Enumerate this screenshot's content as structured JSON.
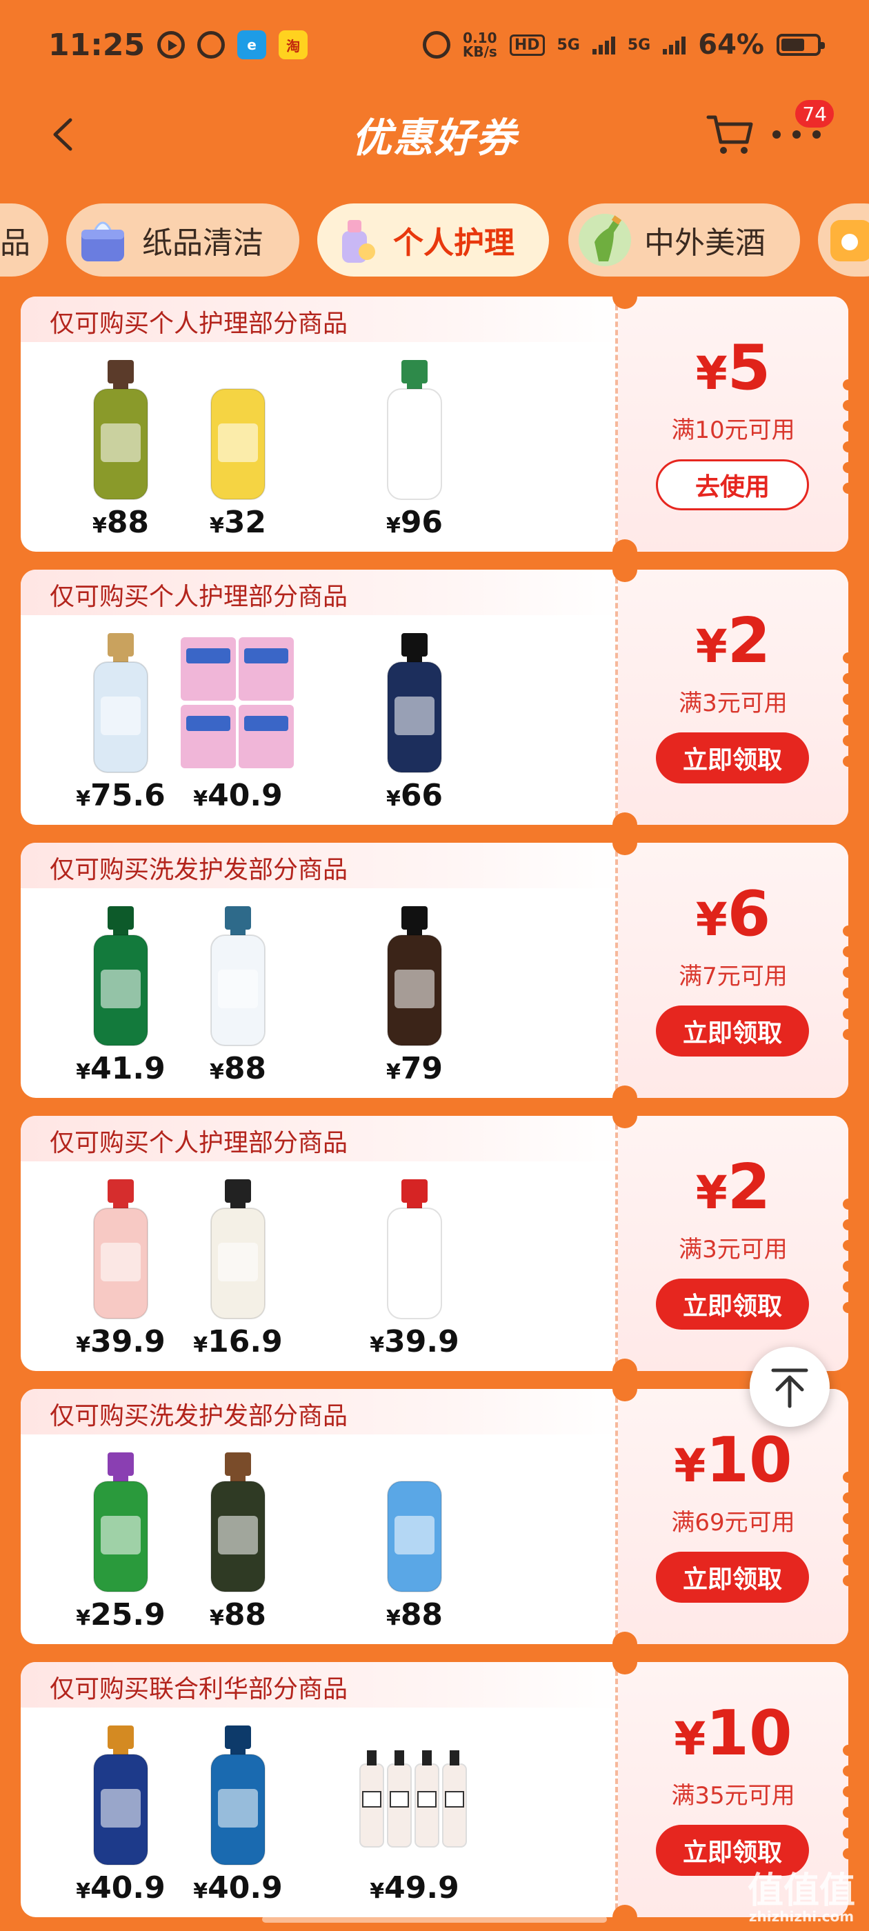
{
  "status_bar": {
    "time": "11:25",
    "app_icons": [
      "play-icon",
      "alarm-icon",
      "browser-icon",
      "taobao-icon"
    ],
    "net_speed_value": "0.10",
    "net_speed_unit": "KB/s",
    "hd": "HD",
    "net1": "5G",
    "net2": "5G",
    "battery": "64%",
    "battery_level": 0.64
  },
  "header": {
    "title": "优惠好券",
    "cart_badge": "74"
  },
  "tabs": [
    {
      "label": "品",
      "active": false
    },
    {
      "label": "纸品清洁",
      "active": false
    },
    {
      "label": "个人护理",
      "active": true
    },
    {
      "label": "中外美酒",
      "active": false
    }
  ],
  "coupons": [
    {
      "title": "仅可购买个人护理部分商品",
      "products": [
        {
          "price": "88"
        },
        {
          "price": "32"
        },
        {
          "price": "96"
        }
      ],
      "currency": "¥",
      "amount": "5",
      "condition": "满10元可用",
      "button": "去使用"
    },
    {
      "title": "仅可购买个人护理部分商品",
      "products": [
        {
          "price": "75.6"
        },
        {
          "price": "40.9"
        },
        {
          "price": "66"
        }
      ],
      "currency": "¥",
      "amount": "2",
      "condition": "满3元可用",
      "button": "立即领取"
    },
    {
      "title": "仅可购买洗发护发部分商品",
      "products": [
        {
          "price": "41.9"
        },
        {
          "price": "88"
        },
        {
          "price": "79"
        }
      ],
      "currency": "¥",
      "amount": "6",
      "condition": "满7元可用",
      "button": "立即领取"
    },
    {
      "title": "仅可购买个人护理部分商品",
      "products": [
        {
          "price": "39.9"
        },
        {
          "price": "16.9"
        },
        {
          "price": "39.9"
        }
      ],
      "currency": "¥",
      "amount": "2",
      "condition": "满3元可用",
      "button": "立即领取"
    },
    {
      "title": "仅可购买洗发护发部分商品",
      "products": [
        {
          "price": "25.9"
        },
        {
          "price": "88"
        },
        {
          "price": "88"
        }
      ],
      "currency": "¥",
      "amount": "10",
      "condition": "满69元可用",
      "button": "立即领取"
    },
    {
      "title": "仅可购买联合利华部分商品",
      "products": [
        {
          "price": "40.9"
        },
        {
          "price": "40.9"
        },
        {
          "price": "49.9"
        }
      ],
      "currency": "¥",
      "amount": "10",
      "condition": "满35元可用",
      "button": "立即领取"
    }
  ],
  "watermark": {
    "main": "值值值",
    "sub": "zhizhizhi.com"
  },
  "colors": {
    "background": "#f4792a",
    "accent_red": "#e6261f",
    "tab_active_text": "#e8380d"
  }
}
